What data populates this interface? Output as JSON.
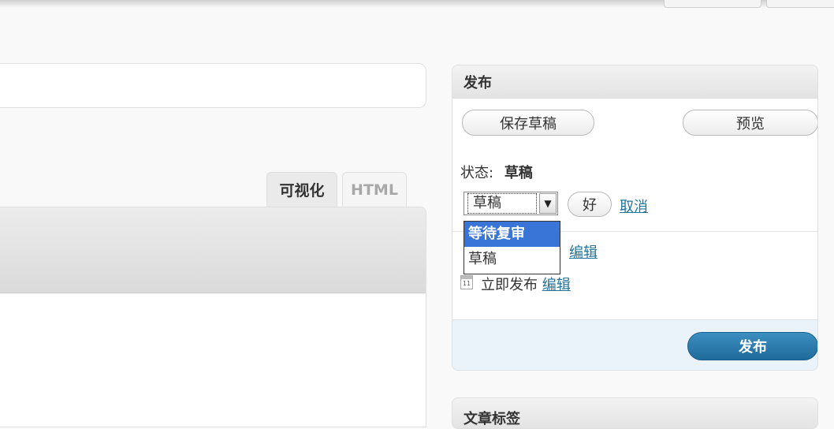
{
  "editor": {
    "tab_visual": "可视化",
    "tab_html": "HTML"
  },
  "publish_box": {
    "title": "发布",
    "save_draft": "保存草稿",
    "preview": "预览",
    "status_label": "状态:",
    "status_value": "草稿",
    "status_select_value": "草稿",
    "ok": "好",
    "cancel": "取消",
    "status_options": [
      "等待复审",
      "草稿"
    ],
    "visibility_edit": "编辑",
    "schedule_text": "立即发布",
    "schedule_edit": "编辑",
    "calendar_icon_text": "11",
    "publish_button": "发布"
  },
  "tags_box": {
    "title": "文章标签"
  }
}
